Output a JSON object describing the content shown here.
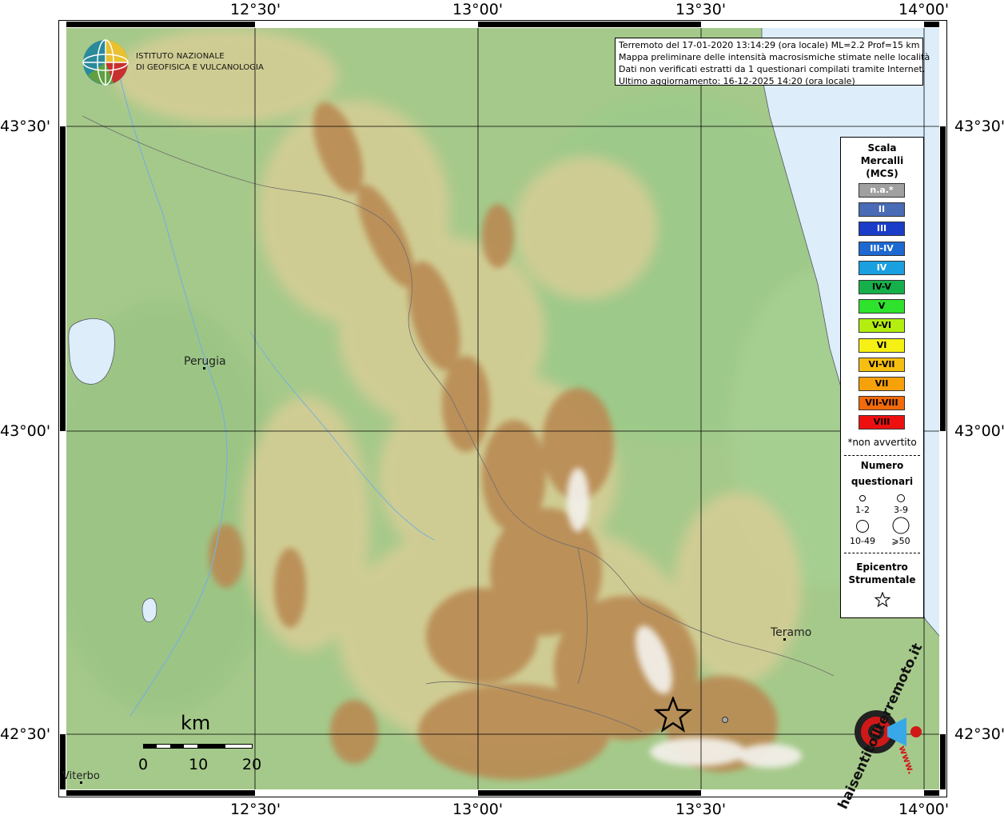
{
  "axes": {
    "top": [
      "12°30'",
      "13°00'",
      "13°30'",
      "14°00'"
    ],
    "bottom": [
      "12°30'",
      "13°00'",
      "13°30'",
      "14°00'"
    ],
    "left": [
      "43°30'",
      "43°00'",
      "42°30'"
    ],
    "right": [
      "43°30'",
      "43°00'",
      "42°30'"
    ]
  },
  "logo": {
    "line1": "ISTITUTO NAZIONALE",
    "line2": "DI GEOFISICA E VULCANOLOGIA"
  },
  "info": {
    "line1": "Terremoto del 17-01-2020 13:14:29 (ora locale) ML=2.2 Prof=15 km",
    "line2": "Mappa preliminare delle intensità macrosismiche stimate nelle località",
    "line3": "Dati non verificati estratti da 1 questionari compilati tramite Internet.",
    "line4": "Ultimo aggiornamento: 16-12-2025 14:20 (ora locale)"
  },
  "legend": {
    "title": [
      "Scala",
      "Mercalli",
      "(MCS)"
    ],
    "items": [
      {
        "label": "n.a.*",
        "color": "#a0a0a0",
        "text": "#ffffff"
      },
      {
        "label": "II",
        "color": "#4a6bb5",
        "text": "#ffffff"
      },
      {
        "label": "III",
        "color": "#1a3cc8",
        "text": "#ffffff"
      },
      {
        "label": "III-IV",
        "color": "#1e68d2",
        "text": "#ffffff"
      },
      {
        "label": "IV",
        "color": "#1aa0e0",
        "text": "#ffffff"
      },
      {
        "label": "IV-V",
        "color": "#16b04a",
        "text": "#000000"
      },
      {
        "label": "V",
        "color": "#2ee22e",
        "text": "#000000"
      },
      {
        "label": "V-VI",
        "color": "#b4ee10",
        "text": "#000000"
      },
      {
        "label": "VI",
        "color": "#f6f014",
        "text": "#000000"
      },
      {
        "label": "VI-VII",
        "color": "#f6be10",
        "text": "#000000"
      },
      {
        "label": "VII",
        "color": "#f6a00a",
        "text": "#000000"
      },
      {
        "label": "VII-VIII",
        "color": "#f26a0a",
        "text": "#000000"
      },
      {
        "label": "VIII",
        "color": "#ee1010",
        "text": "#000000"
      }
    ],
    "note": "*non avvertito",
    "questionnaires_title": [
      "Numero",
      "questionari"
    ],
    "sizes": [
      "1-2",
      "3-9",
      "10-49",
      "⩾50"
    ],
    "epicenter_title": [
      "Epicentro",
      "Strumentale"
    ]
  },
  "cities": {
    "perugia": "Perugia",
    "teramo": "Teramo",
    "viterbo": "Viterbo"
  },
  "scalebar": {
    "unit": "km",
    "labels": [
      "0",
      "10",
      "20"
    ]
  },
  "watermark": {
    "text": "haisentitoilterremoto.it",
    "sub": "www."
  },
  "colors": {
    "sea": "#ddeefa",
    "lowland": "#a7c98a",
    "hills": "#d8cf98",
    "mountains": "#b98a50"
  }
}
